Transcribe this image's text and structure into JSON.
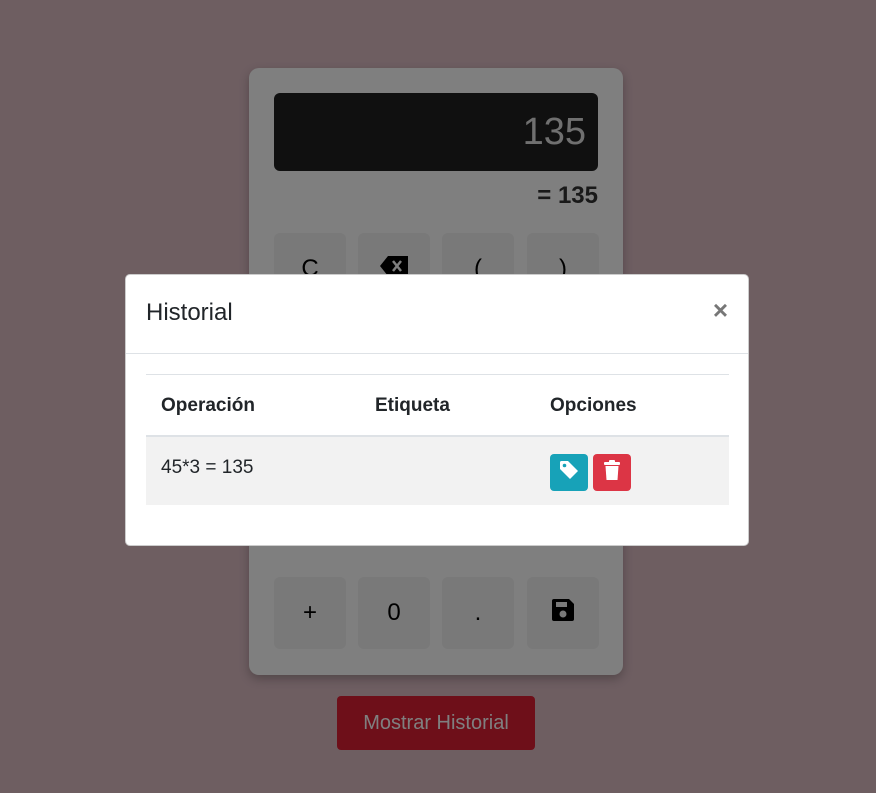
{
  "calculator": {
    "display": "135",
    "result": "= 135",
    "keys_top": [
      "C",
      "⌫",
      "(",
      ")"
    ],
    "keys_bottom": [
      "+",
      "0",
      ".",
      "save"
    ]
  },
  "history_button": "Mostrar Historial",
  "modal": {
    "title": "Historial",
    "close": "×",
    "columns": [
      "Operación",
      "Etiqueta",
      "Opciones"
    ],
    "rows": [
      {
        "operation": "45*3 = 135",
        "label": ""
      }
    ]
  },
  "colors": {
    "background": "#dcbcc3",
    "primary_button": "#dc1e33",
    "tag_button": "#17a2b8",
    "delete_button": "#dc3545"
  }
}
